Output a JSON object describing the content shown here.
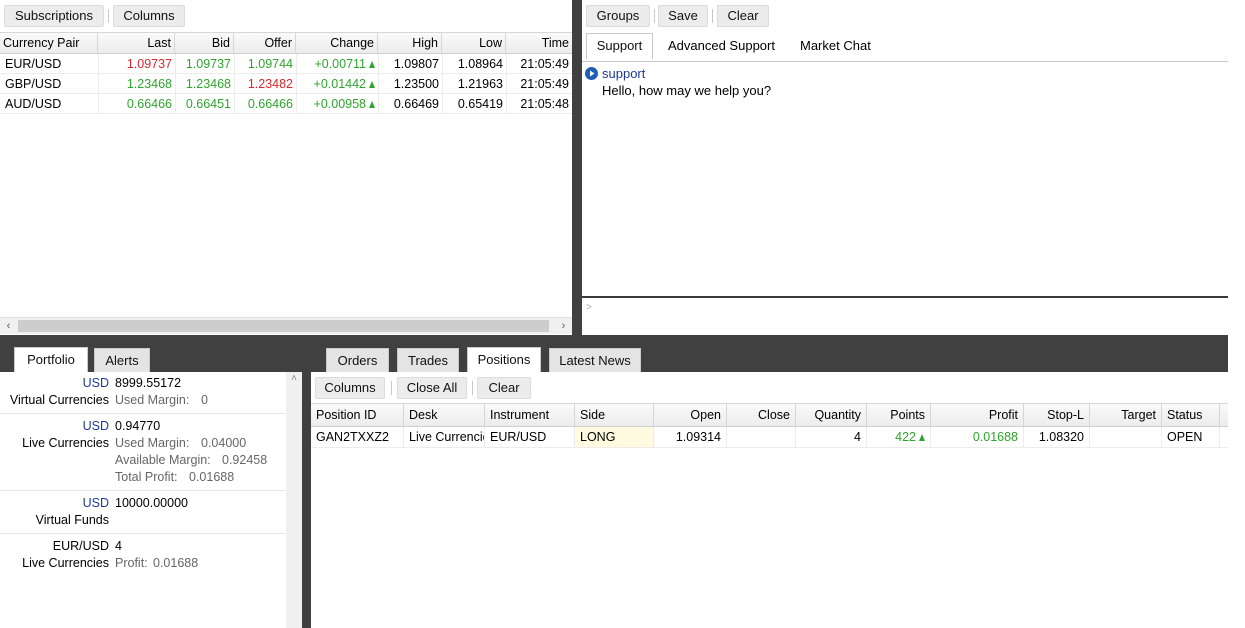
{
  "quotes_toolbar": {
    "subscriptions": "Subscriptions",
    "columns": "Columns"
  },
  "quotes_table": {
    "headers": [
      "Currency Pair",
      "Last",
      "Bid",
      "Offer",
      "Change",
      "High",
      "Low",
      "Time"
    ],
    "rows": [
      {
        "pair": "EUR/USD",
        "last": "1.09737",
        "bid": "1.09737",
        "offer": "1.09744",
        "change": "+0.00711",
        "high": "1.09807",
        "low": "1.08964",
        "time": "21:05:49"
      },
      {
        "pair": "GBP/USD",
        "last": "1.23468",
        "bid": "1.23468",
        "offer": "1.23482",
        "change": "+0.01442",
        "high": "1.23500",
        "low": "1.21963",
        "time": "21:05:49"
      },
      {
        "pair": "AUD/USD",
        "last": "0.66466",
        "bid": "0.66451",
        "offer": "0.66466",
        "change": "+0.00958",
        "high": "0.66469",
        "low": "0.65419",
        "time": "21:05:48"
      }
    ]
  },
  "chat_toolbar": {
    "groups": "Groups",
    "save": "Save",
    "clear": "Clear"
  },
  "chat_tabs": [
    "Support",
    "Advanced Support",
    "Market Chat"
  ],
  "chat": {
    "sender": "support",
    "message": "Hello, how may we help you?",
    "prompt": ">"
  },
  "portfolio_tabs": [
    "Portfolio",
    "Alerts"
  ],
  "portfolio": {
    "blocks": [
      {
        "currency": "USD",
        "amount": "8999.55172",
        "name": "Virtual Currencies",
        "details": [
          {
            "label": "Used Margin:",
            "value": "0"
          }
        ]
      },
      {
        "currency": "USD",
        "amount": "0.94770",
        "name": "Live Currencies",
        "details": [
          {
            "label": "Used Margin:",
            "value": "0.04000"
          },
          {
            "label": "Available Margin:",
            "value": "0.92458"
          },
          {
            "label": "Total Profit:",
            "value": "0.01688"
          }
        ]
      },
      {
        "currency": "USD",
        "amount": "10000.00000",
        "name": "Virtual Funds",
        "details": []
      },
      {
        "currency": "EUR/USD",
        "amount": "4",
        "name": "Live Currencies",
        "details": [
          {
            "label": "Profit:",
            "value": "0.01688"
          }
        ]
      }
    ]
  },
  "orders_tabs": [
    "Orders",
    "Trades",
    "Positions",
    "Latest News"
  ],
  "positions_toolbar": {
    "columns": "Columns",
    "close_all": "Close All",
    "clear": "Clear"
  },
  "positions_table": {
    "headers": [
      "Position ID",
      "Desk",
      "Instrument",
      "Side",
      "Open",
      "Close",
      "Quantity",
      "Points",
      "Profit",
      "Stop-L",
      "Target",
      "Status"
    ],
    "rows": [
      {
        "id": "GAN2TXXZ2",
        "desk": "Live Currencies",
        "instrument": "EUR/USD",
        "side": "LONG",
        "open": "1.09314",
        "close": "",
        "quantity": "4",
        "points": "422",
        "profit": "0.01688",
        "stop_loss": "1.08320",
        "target": "",
        "status": "OPEN"
      }
    ]
  },
  "colors": {
    "price_up": "#2ea52e",
    "price_down": "#d9282f",
    "divider": "#404040",
    "link_blue": "#1f3a93",
    "long_highlight": "#fffbe0"
  }
}
